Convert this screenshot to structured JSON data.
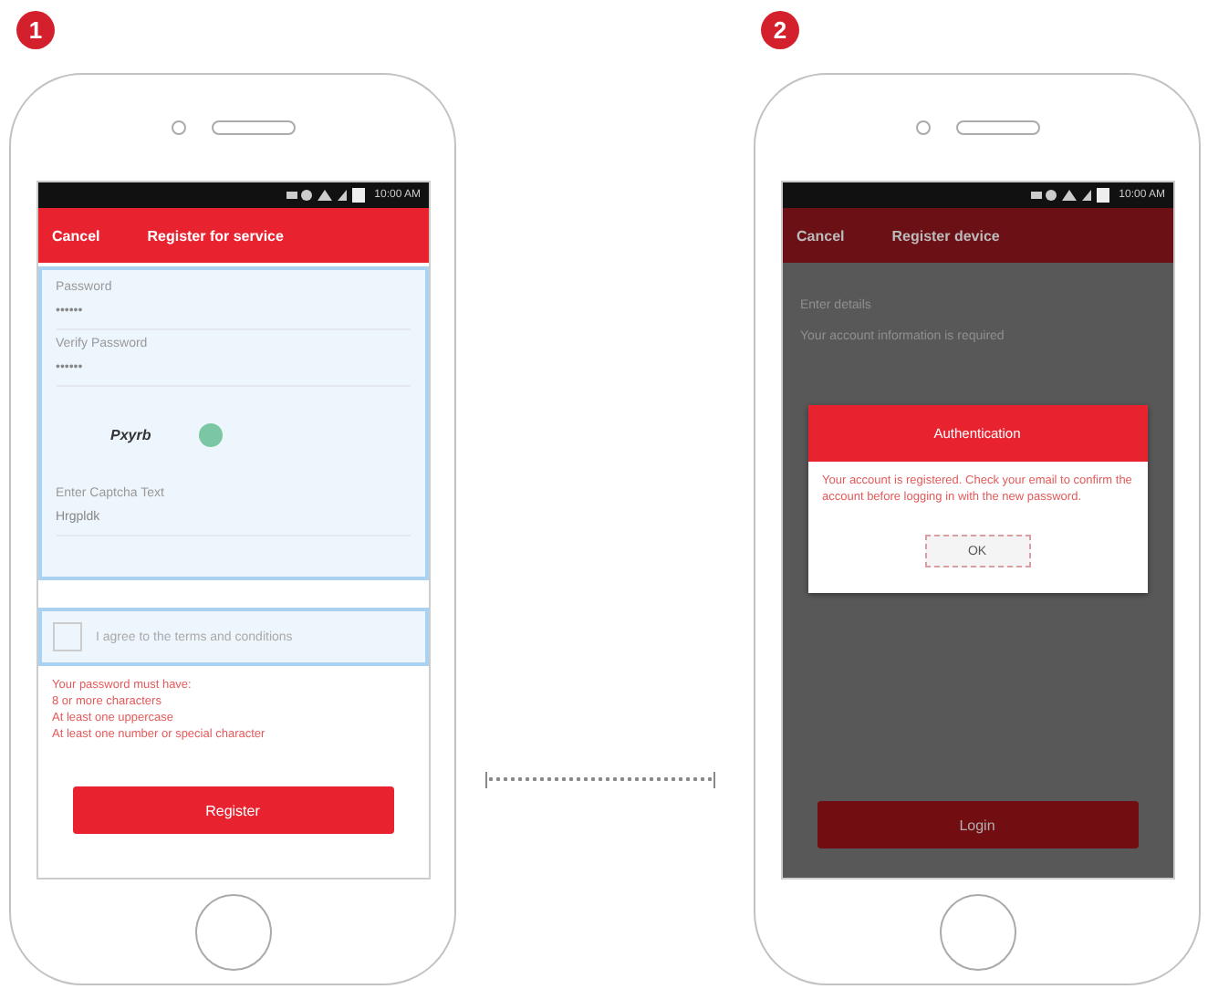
{
  "steps": [
    {
      "badge": "1",
      "screen": {
        "kind": "register",
        "time": "10:00 AM",
        "header": {
          "left": "Cancel",
          "title": "Register for service"
        },
        "fields": [
          {
            "label": "Password",
            "value": "••••••"
          },
          {
            "label": "Verify Password",
            "value": "••••••"
          }
        ],
        "captcha": {
          "text": "Pxyrb"
        },
        "captcha_field": {
          "label": "Enter Captcha Text",
          "value": "Hrgpldk"
        },
        "agree": {
          "label": "I agree to the terms and conditions",
          "checked": false
        },
        "rules": [
          "Your password must have:",
          "8 or more characters",
          "At least one uppercase",
          "At least one number or special character"
        ],
        "button": "Register"
      }
    },
    {
      "badge": "2",
      "screen": {
        "kind": "dialog",
        "time": "10:00 AM",
        "dimmed": true,
        "header": {
          "left": "Cancel",
          "title": "Register device"
        },
        "lines": [
          "Enter details",
          "Your account information is required"
        ],
        "dialog": {
          "title": "Authentication",
          "message": "Your account is registered. Check your email to confirm the account before logging in with the new password.",
          "button": "OK"
        },
        "button": "Login"
      }
    }
  ]
}
